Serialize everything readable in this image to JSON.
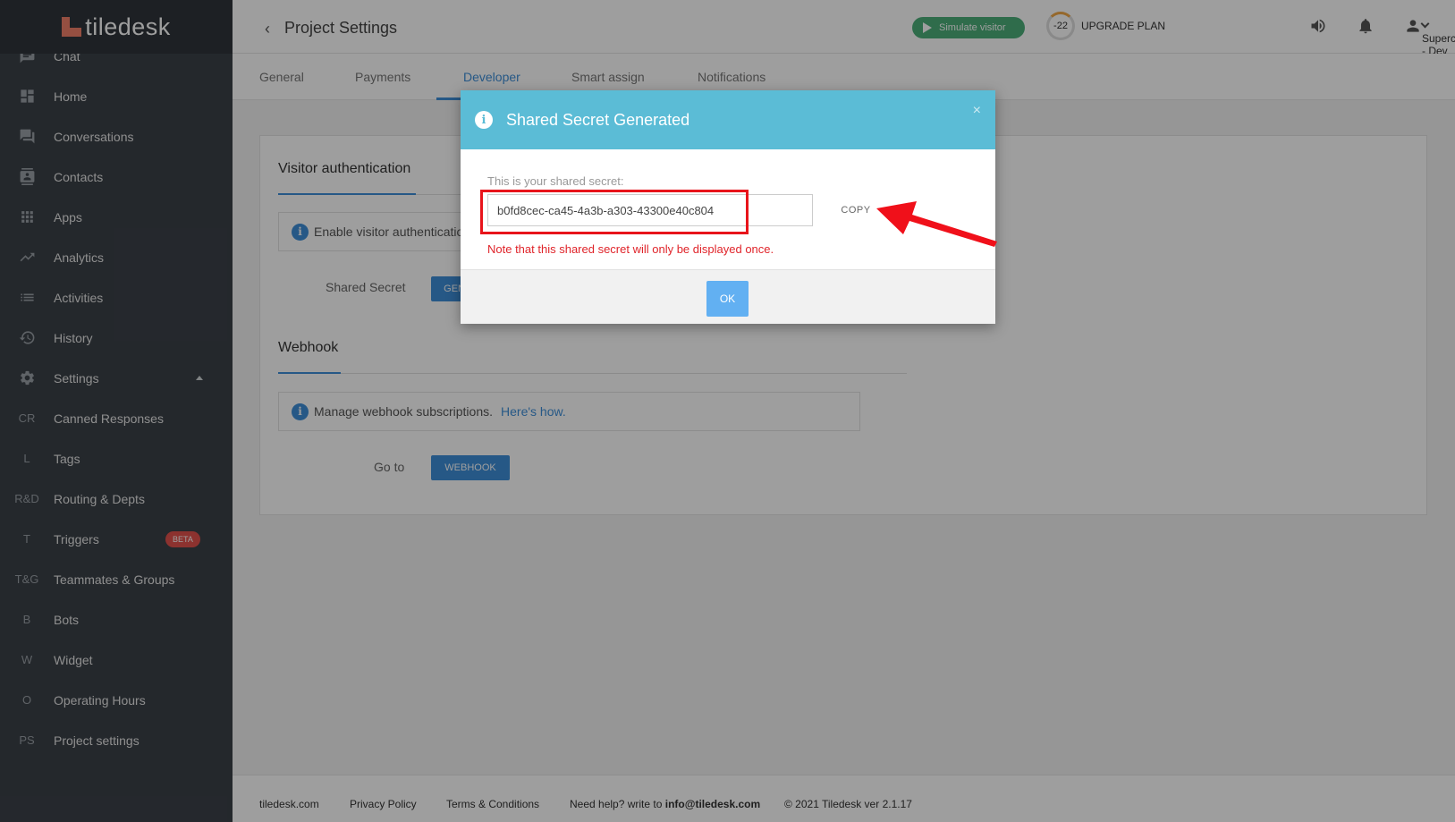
{
  "app": {
    "logo_text": "tiledesk"
  },
  "sidebar": {
    "items": [
      {
        "label": "Chat",
        "icon": "chat-icon"
      },
      {
        "label": "Home",
        "icon": "dashboard-icon"
      },
      {
        "label": "Conversations",
        "icon": "forum-icon"
      },
      {
        "label": "Contacts",
        "icon": "contacts-icon"
      },
      {
        "label": "Apps",
        "icon": "apps-grid-icon"
      },
      {
        "label": "Analytics",
        "icon": "trending-icon"
      },
      {
        "label": "Activities",
        "icon": "list-icon"
      },
      {
        "label": "History",
        "icon": "history-icon"
      },
      {
        "label": "Settings",
        "icon": "gear-icon"
      },
      {
        "label": "Canned Responses",
        "abbr": "CR"
      },
      {
        "label": "Tags",
        "abbr": "L"
      },
      {
        "label": "Routing & Depts",
        "abbr": "R&D"
      },
      {
        "label": "Triggers",
        "abbr": "T",
        "badge": "BETA"
      },
      {
        "label": "Teammates & Groups",
        "abbr": "T&G"
      },
      {
        "label": "Bots",
        "abbr": "B"
      },
      {
        "label": "Widget",
        "abbr": "W"
      },
      {
        "label": "Operating Hours",
        "abbr": "O"
      },
      {
        "label": "Project settings",
        "abbr": "PS"
      }
    ]
  },
  "header": {
    "title": "Project Settings",
    "simulate_label": "Simulate visitor",
    "plan_counter": "-22",
    "upgrade_label": "UPGRADE PLAN",
    "project_name": "Superchat - Dev"
  },
  "tabs": [
    "General",
    "Payments",
    "Developer",
    "Smart assign",
    "Notifications"
  ],
  "active_tab": "Developer",
  "visitor_auth": {
    "title": "Visitor authentication",
    "info_text": "Enable visitor authentication",
    "shared_secret_label": "Shared Secret",
    "generate_label": "GENERATE"
  },
  "webhook": {
    "title": "Webhook",
    "info_text": "Manage webhook subscriptions.",
    "info_link": "Here's how.",
    "goto_label": "Go to",
    "button_label": "WEBHOOK"
  },
  "footer": {
    "site": "tiledesk.com",
    "privacy": "Privacy Policy",
    "terms": "Terms & Conditions",
    "help_prefix": "Need help? write to",
    "help_email": "info@tiledesk.com",
    "copyright": "© 2021 Tiledesk ver 2.1.17"
  },
  "modal": {
    "title": "Shared Secret Generated",
    "close_glyph": "×",
    "secret_label": "This is your shared secret:",
    "secret_value": "b0fd8cec-ca45-4a3b-a303-43300e40c804",
    "copy_label": "COPY",
    "note": "Note that this shared secret will only be displayed once.",
    "ok_label": "OK"
  },
  "colors": {
    "sidebar_bg": "#3b4148",
    "accent_blue": "#3e8fd8",
    "modal_header": "#5bbcd6",
    "ok_button": "#62b0f2",
    "highlight_red": "#e8141b",
    "simulate_green": "#4caf7a",
    "beta_red": "#e2524d"
  }
}
